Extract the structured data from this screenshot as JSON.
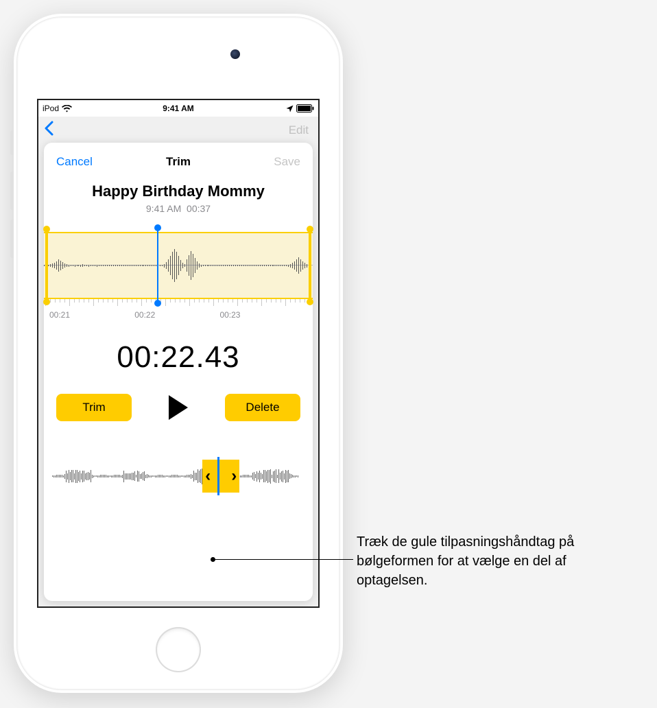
{
  "status_bar": {
    "carrier": "iPod",
    "time": "9:41 AM"
  },
  "background": {
    "edit_label": "Edit"
  },
  "sheet": {
    "cancel_label": "Cancel",
    "title": "Trim",
    "save_label": "Save",
    "recording_name": "Happy Birthday Mommy",
    "recording_time": "9:41 AM",
    "recording_duration": "00:37",
    "zoom_ticks": [
      "00:21",
      "00:22",
      "00:23"
    ],
    "playhead_time": "00:22.43",
    "trim_button": "Trim",
    "delete_button": "Delete"
  },
  "callout": {
    "text": "Træk de gule tilpasningshåndtag på bølgeformen for at vælge en del af optagelsen."
  }
}
